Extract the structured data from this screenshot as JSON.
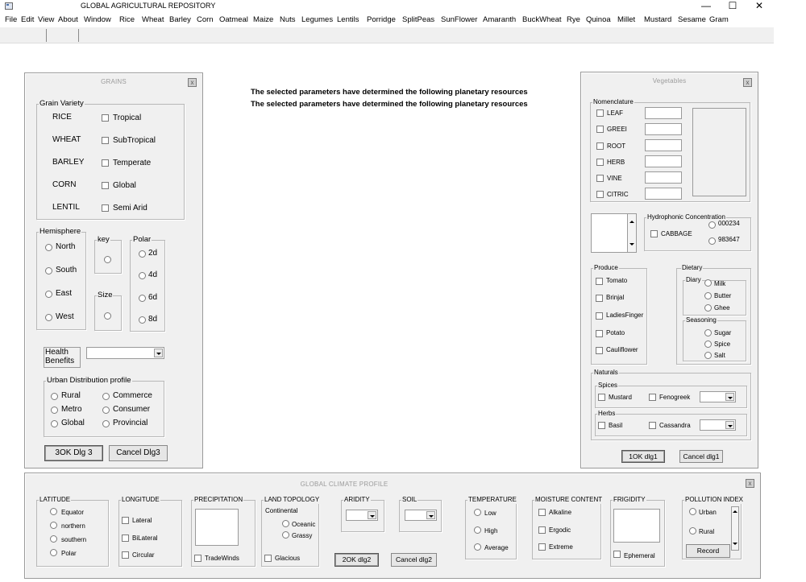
{
  "window": {
    "title": "GLOBAL AGRICULTURAL REPOSITORY",
    "minimize": "—",
    "maximize": "☐",
    "close": "✕"
  },
  "menu": [
    "File",
    "Edit",
    "View",
    "About",
    "Window",
    "Rice",
    "Wheat",
    "Barley",
    "Corn",
    "Oatmeal",
    "Maize",
    "Nuts",
    "Legumes",
    "Lentils",
    "Porridge",
    "SplitPeas",
    "SunFlower",
    "Amaranth",
    "BuckWheat",
    "Rye",
    "Quinoa",
    "Millet",
    "Mustard",
    "Sesame",
    "Gram"
  ],
  "messages": [
    "The selected parameters have determined the following planetary resources",
    "The selected parameters have determined the following planetary resources"
  ],
  "grains": {
    "title": "GRAINS",
    "close": "x",
    "variety": {
      "label": "Grain Variety",
      "names": [
        "RICE",
        "WHEAT",
        "BARLEY",
        "CORN",
        "LENTIL"
      ],
      "climates": [
        "Tropical",
        "SubTropical",
        "Temperate",
        "Global",
        "Semi Arid"
      ]
    },
    "hemisphere": {
      "label": "Hemisphere",
      "options": [
        "North",
        "South",
        "East",
        "West"
      ]
    },
    "key": {
      "label": "key"
    },
    "size": {
      "label": "Size"
    },
    "polar": {
      "label": "Polar",
      "options": [
        "2d",
        "4d",
        "6d",
        "8d"
      ]
    },
    "health": {
      "label_1": "Health",
      "label_2": "Benefits",
      "value": ""
    },
    "urban": {
      "label": "Urban Distribution profile",
      "left": [
        "Rural",
        "Metro",
        "Global"
      ],
      "right": [
        "Commerce",
        "Consumer",
        "Provincial"
      ]
    },
    "ok": "3OK Dlg 3",
    "cancel": "Cancel Dlg3"
  },
  "vegetables": {
    "title": "Vegetables",
    "close": "x",
    "nomenclature": {
      "label": "Nomenclature",
      "items": [
        "LEAF",
        "GREEI",
        "ROOT",
        "HERB",
        "VINE",
        "CITRIC"
      ]
    },
    "hydro": {
      "label": "Hydrophonic Concentration",
      "cabbage": "CABBAGE",
      "values": [
        "000234",
        "983647"
      ]
    },
    "produce": {
      "label": "Produce",
      "items": [
        "Tomato",
        "Brinjal",
        "LadiesFinger",
        "Potato",
        "Cauliflower"
      ]
    },
    "dietary": {
      "label": "Dietary",
      "diary": {
        "label": "Diary",
        "items": [
          "Milk",
          "Butter",
          "Ghee"
        ]
      },
      "seasoning": {
        "label": "Seasoning",
        "items": [
          "Sugar",
          "Spice",
          "Salt"
        ]
      }
    },
    "naturals": {
      "label": "Naturals",
      "spices": {
        "label": "Spices",
        "a": "Mustard",
        "b": "Fenogreek"
      },
      "herbs": {
        "label": "Herbs",
        "a": "Basil",
        "b": "Cassandra"
      }
    },
    "ok": "1OK dlg1",
    "cancel": "Cancel dlg1"
  },
  "climate": {
    "title": "GLOBAL CLIMATE PROFILE",
    "close": "x",
    "latitude": {
      "label": "LATITUDE",
      "options": [
        "Equator",
        "northern",
        "southern",
        "Polar"
      ]
    },
    "longitude": {
      "label": "LONGITUDE",
      "options": [
        "Lateral",
        "BiLateral",
        "Circular"
      ]
    },
    "precipitation": {
      "label": "PRECIPITATION",
      "tradewinds": "TradeWinds"
    },
    "land": {
      "label": "LAND TOPOLOGY",
      "continental": "Continental",
      "options": [
        "Oceanic",
        "Grassy"
      ],
      "glacious": "Glacious"
    },
    "aridity": {
      "label": "ARIDITY"
    },
    "soil": {
      "label": "SOIL"
    },
    "ok": "2OK dlg2",
    "cancel": "Cancel dlg2",
    "temperature": {
      "label": "TEMPERATURE",
      "options": [
        "Low",
        "High",
        "Average"
      ]
    },
    "moisture": {
      "label": "MOISTURE CONTENT",
      "options": [
        "Alkaline",
        "Ergodic",
        "Extreme"
      ]
    },
    "frigidity": {
      "label": "FRIGIDITY",
      "ephemeral": "Ephemeral"
    },
    "pollution": {
      "label": "POLLUTION INDEX",
      "options": [
        "Urban",
        "Rural"
      ],
      "record": "Record"
    }
  }
}
